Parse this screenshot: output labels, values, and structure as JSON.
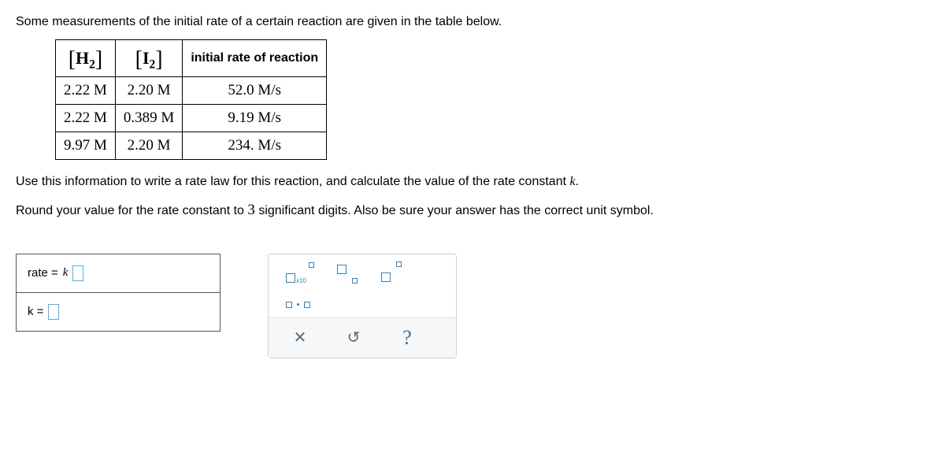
{
  "intro": "Some measurements of the initial rate of a certain reaction are given in the table below.",
  "table": {
    "headers": {
      "h2_inner": "H",
      "h2_sub": "2",
      "i2_inner": "I",
      "i2_sub": "2",
      "rate": "initial rate of reaction"
    },
    "rows": [
      {
        "h2": "2.22 M",
        "i2": "2.20 M",
        "rate": "52.0 M/s"
      },
      {
        "h2": "2.22 M",
        "i2": "0.389 M",
        "rate": "9.19 M/s"
      },
      {
        "h2": "9.97 M",
        "i2": "2.20 M",
        "rate": "234. M/s"
      }
    ]
  },
  "instr1_a": "Use this information to write a rate law for this reaction, and calculate the value of the rate constant ",
  "instr1_k": "k",
  "instr1_b": ".",
  "instr2_a": "Round your value for the rate constant to ",
  "instr2_num": "3",
  "instr2_b": " significant digits. Also be sure your answer has the correct unit symbol.",
  "answers": {
    "rate_prefix": "rate =",
    "rate_k": "k",
    "k_prefix": "k ="
  },
  "palette": {
    "sci_x10": "x10",
    "clear": "✕",
    "undo": "↺",
    "help": "?"
  }
}
